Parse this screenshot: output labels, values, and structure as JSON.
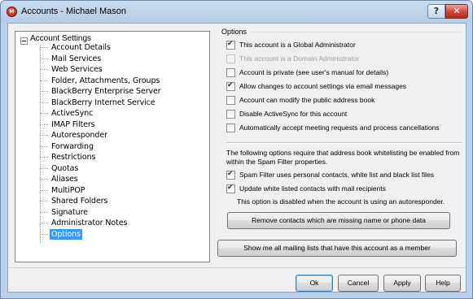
{
  "window": {
    "title": "Accounts - Michael Mason",
    "app_icon_letter": "M"
  },
  "caption_buttons": {
    "help": "?",
    "close": "✕"
  },
  "tree": {
    "root": "Account Settings",
    "items": [
      "Account Details",
      "Mail Services",
      "Web Services",
      "Folder, Attachments, Groups",
      "BlackBerry Enterprise Server",
      "BlackBerry Internet Service",
      "ActiveSync",
      "IMAP Filters",
      "Autoresponder",
      "Forwarding",
      "Restrictions",
      "Quotas",
      "Aliases",
      "MultiPOP",
      "Shared Folders",
      "Signature",
      "Administrator Notes",
      "Options"
    ],
    "selected": "Options"
  },
  "options": {
    "group_label": "Options",
    "checkboxes": [
      {
        "label": "This account is a Global Administrator",
        "checked": true,
        "disabled": false
      },
      {
        "label": "This account is a Domain Administrator",
        "checked": false,
        "disabled": true
      },
      {
        "label": "Account is private (see user's manual for details)",
        "checked": false,
        "disabled": false
      },
      {
        "label": "Allow changes to account settings via email messages",
        "checked": true,
        "disabled": false
      },
      {
        "label": "Account can modify the public address book",
        "checked": false,
        "disabled": false
      },
      {
        "label": "Disable ActiveSync for this account",
        "checked": false,
        "disabled": false
      },
      {
        "label": "Automatically accept meeting requests and process cancellations",
        "checked": false,
        "disabled": false
      }
    ],
    "whitelist_note_line1": "The following options require that address book whitelisting be enabled from",
    "whitelist_note_line2": "within the Spam Filter properties.",
    "whitelist_checkboxes": [
      {
        "label": "Spam Filter uses personal contacts, white list and black list files",
        "checked": true
      },
      {
        "label": "Update white listed contacts with mail recipients",
        "checked": true
      }
    ],
    "autoresponder_note": "This option is disabled when the account is using an autoresponder.",
    "remove_contacts_button": "Remove contacts which are missing name or phone data",
    "show_lists_button": "Show me all mailing lists that have this account as a member"
  },
  "footer": {
    "ok": "Ok",
    "cancel": "Cancel",
    "apply": "Apply",
    "help": "Help"
  }
}
